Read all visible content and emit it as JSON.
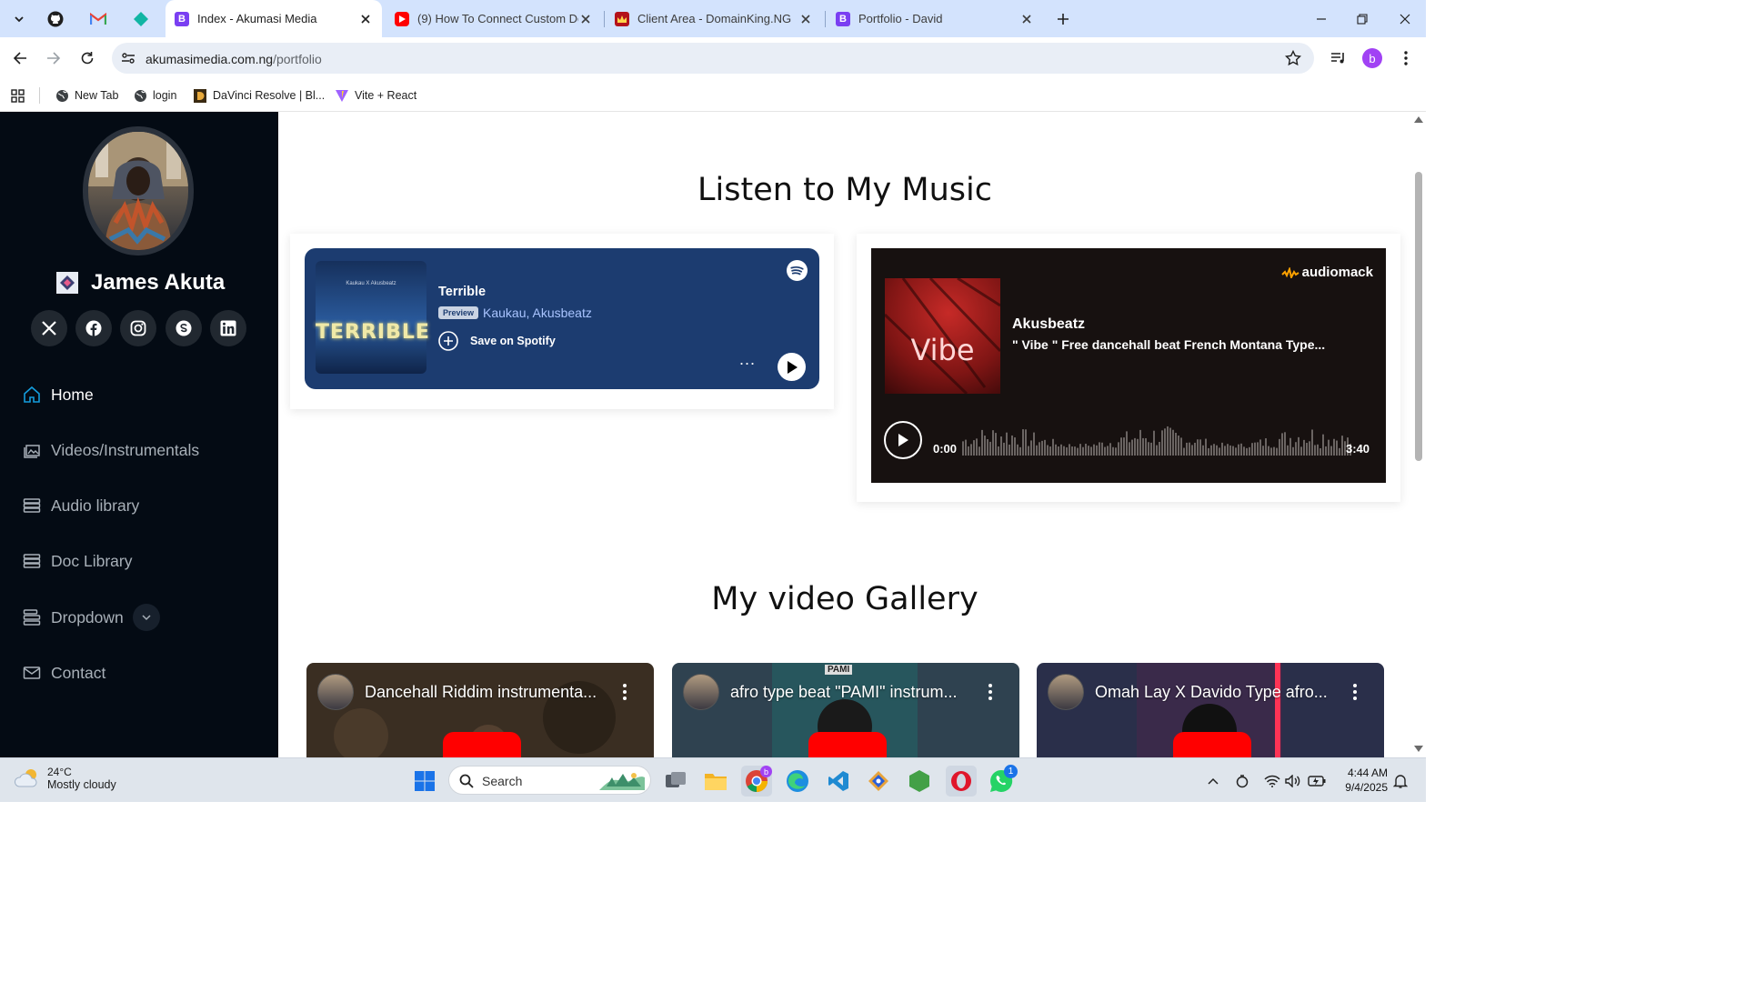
{
  "browser": {
    "tabs": [
      {
        "title": "Index - Akumasi Media",
        "icon": "bootstrap-favicon",
        "active": true
      },
      {
        "title": "(9) How To Connect Custom Do",
        "icon": "youtube-favicon",
        "active": false
      },
      {
        "title": "Client Area - DomainKing.NG",
        "icon": "domainking-favicon",
        "active": false
      },
      {
        "title": "Portfolio - David",
        "icon": "bootstrap-favicon",
        "active": false
      }
    ],
    "pinned_tabs": [
      "github-icon",
      "gmail-icon",
      "diamond-app-icon"
    ],
    "new_tab_symbol": "+",
    "url_host": "akumasimedia.com.ng",
    "url_path": "/portfolio",
    "profile_initial": "b",
    "bookmarks": [
      {
        "label": "New Tab",
        "icon": "globe-icon"
      },
      {
        "label": "login",
        "icon": "globe-icon"
      },
      {
        "label": "DaVinci Resolve | Bl...",
        "icon": "davinci-icon"
      },
      {
        "label": "Vite + React",
        "icon": "vite-icon"
      }
    ]
  },
  "sidebar": {
    "name": "James Akuta",
    "socials": [
      "x-icon",
      "facebook-icon",
      "instagram-icon",
      "skype-icon",
      "linkedin-icon"
    ],
    "nav": [
      {
        "label": "Home",
        "icon": "house-icon",
        "active": true
      },
      {
        "label": "Videos/Instrumentals",
        "icon": "images-icon",
        "active": false
      },
      {
        "label": "Audio library",
        "icon": "server-icon",
        "active": false
      },
      {
        "label": "Doc Library",
        "icon": "server-icon",
        "active": false
      },
      {
        "label": "Dropdown",
        "icon": "menu-list-icon",
        "active": false
      },
      {
        "label": "Contact",
        "icon": "envelope-icon",
        "active": false
      }
    ]
  },
  "main": {
    "music_title": "Listen to My Music",
    "spotify": {
      "title": "Terrible",
      "badge": "Preview",
      "artists": "Kaukau, Akusbeatz",
      "save_label": "Save on Spotify",
      "cover_top": "Kaukau X Akusbeatz",
      "cover_text": "TERRIBLE",
      "more": "..."
    },
    "audiomack": {
      "brand": "audiomack",
      "artist": "Akusbeatz",
      "track": "\" Vibe \" Free dancehall beat French Montana Type...",
      "cover_text": "Vibe",
      "time_start": "0:00",
      "time_end": "3:40"
    },
    "gallery_title": "My video Gallery",
    "videos": [
      {
        "title": "Dancehall Riddim instrumenta...",
        "bg": "#3a2e22"
      },
      {
        "title": "afro type beat \"PAMI\" instrum...",
        "bg": "#2f4250",
        "overlay": "PAMI"
      },
      {
        "title": "Omah Lay X Davido Type afro...",
        "bg": "#2a2f4a"
      }
    ]
  },
  "taskbar": {
    "temperature": "24°C",
    "condition": "Mostly cloudy",
    "search_label": "Search",
    "time": "4:44 AM",
    "date": "9/4/2025",
    "whatsapp_badge": "1",
    "chrome_badge": "b"
  },
  "colors": {
    "sidebar_bg": "#040b14",
    "spotify_bg": "#1c3c70",
    "audiomack_bg": "#171110",
    "tab_strip": "#d3e3fd",
    "audiomack_orange": "#ffa200"
  }
}
